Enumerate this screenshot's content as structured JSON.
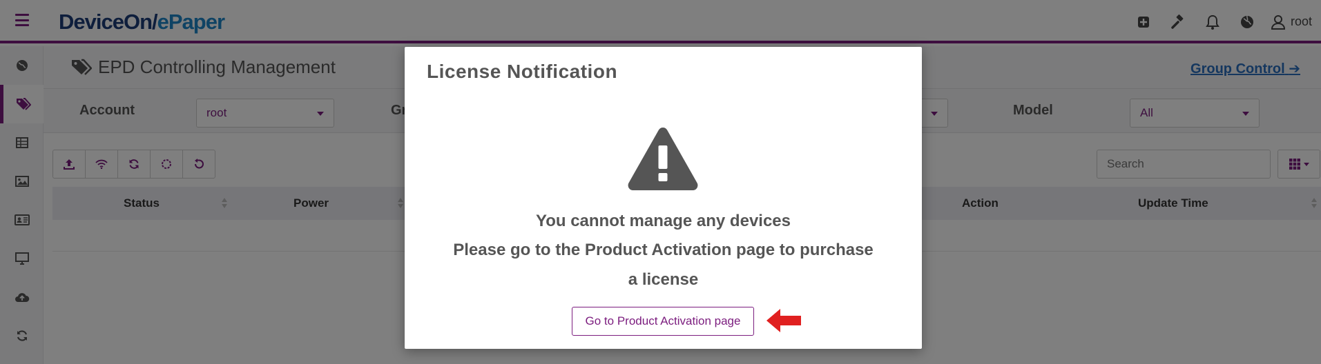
{
  "app": {
    "logo_part1": "DeviceOn/",
    "logo_part2": "ePaper",
    "user": "root"
  },
  "icons": {
    "menu": "hamburger-icon",
    "top": [
      "plus-square-icon",
      "gavel-icon",
      "bell-icon",
      "globe-icon",
      "user-icon"
    ],
    "sidebar": [
      "globe-icon",
      "tags-icon",
      "table-icon",
      "image-icon",
      "id-card-icon",
      "monitor-icon",
      "cloud-upload-icon",
      "refresh-icon"
    ],
    "toolbar": [
      "upload-icon",
      "wifi-icon",
      "refresh-icon",
      "loading-circle-icon",
      "undo-icon"
    ],
    "columns": "grid-icon"
  },
  "page": {
    "title": "EPD Controlling Management",
    "group_control": "Group Control"
  },
  "filters": {
    "account_label": "Account",
    "account_value": "root",
    "group_label_partial": "Gr",
    "model_label": "Model",
    "model_value": "All"
  },
  "search": {
    "placeholder": "Search"
  },
  "table": {
    "headers": {
      "status": "Status",
      "power": "Power",
      "action": "Action",
      "update_time": "Update Time"
    }
  },
  "modal": {
    "title": "License Notification",
    "line1": "You cannot manage any devices",
    "line2": "Please go to the Product Activation page to purchase",
    "line3": "a license",
    "button": "Go to Product Activation page"
  },
  "colors": {
    "brand_purple": "#7b1c7e",
    "logo_dark": "#1c3c78",
    "logo_light": "#1e86c9",
    "link_blue": "#2a6fbf",
    "annotation_arrow": "#e02020"
  }
}
